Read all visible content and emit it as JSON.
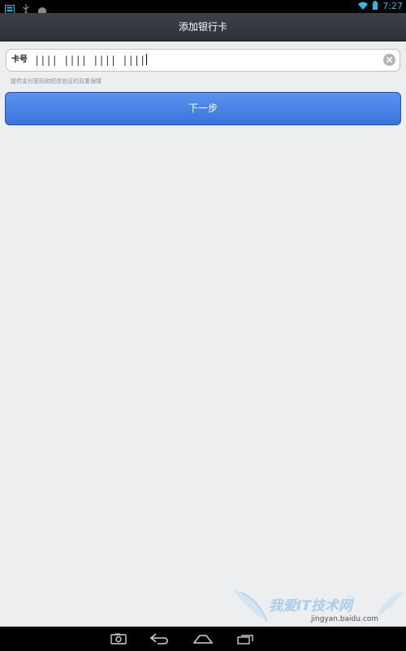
{
  "status_bar": {
    "time": "7:27",
    "icons_left": [
      "notification-icon",
      "usb-icon",
      "android-icon"
    ],
    "icons_right": [
      "wifi-icon",
      "battery-icon"
    ]
  },
  "header": {
    "title": "添加银行卡"
  },
  "card_field": {
    "label": "卡号",
    "value": "|||| |||| |||| ||||"
  },
  "hint": "提供支付密码和短信验证的双重保障",
  "next_button": {
    "label": "下一步"
  },
  "watermark": {
    "title": "我爱IT技术网",
    "url": "jingyan.baidu.com"
  },
  "nav_bar": {
    "icons": [
      "camera-icon",
      "back-icon",
      "home-icon",
      "recent-apps-icon"
    ]
  },
  "colors": {
    "accent": "#3b73dc",
    "status_icon": "#33b5e5",
    "title_bar": "#2c3037",
    "background": "#eceef0"
  }
}
